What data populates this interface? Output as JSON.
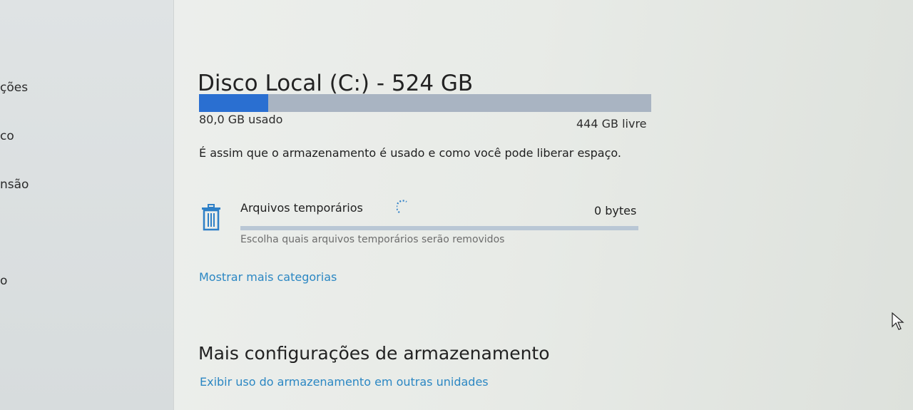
{
  "sidebar": {
    "items": [
      {
        "label": "ções"
      },
      {
        "label": "co"
      },
      {
        "label": "nsão"
      },
      {
        "label": "o"
      }
    ]
  },
  "disk": {
    "title": "Disco Local (C:) - 524 GB",
    "used_label": "80,0 GB usado",
    "free_label": "444 GB livre",
    "used_fraction": 0.153,
    "description": "É assim que o armazenamento é usado e como você pode liberar espaço."
  },
  "category": {
    "icon": "trash-icon",
    "name": "Arquivos temporários",
    "size": "0 bytes",
    "subtitle": "Escolha quais arquivos temporários serão removidos",
    "loading": true
  },
  "links": {
    "show_more": "Mostrar mais categorias",
    "other_drives": "Exibir uso do armazenamento em outras unidades"
  },
  "more_settings": {
    "title": "Mais configurações de armazenamento"
  },
  "colors": {
    "accent": "#2a6fd1",
    "link": "#2b87c3",
    "bar_track": "#a9b4c2"
  }
}
